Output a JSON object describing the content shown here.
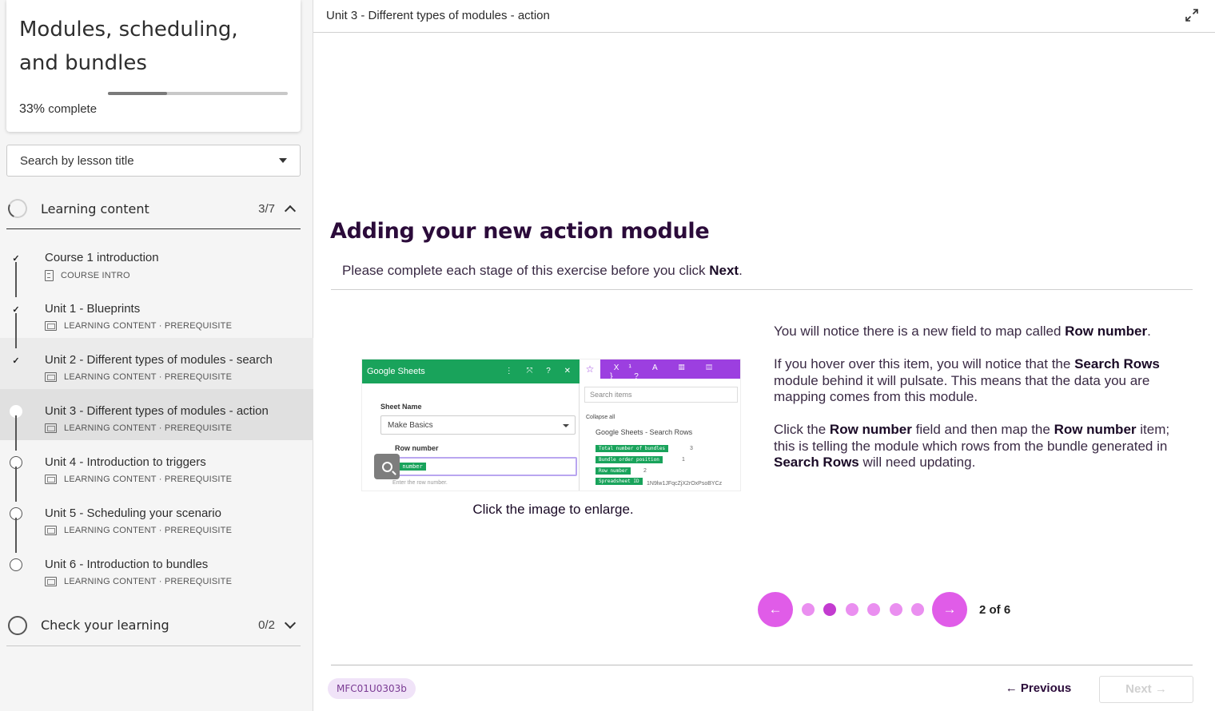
{
  "sidebar": {
    "course_title": "Modules, scheduling, and bundles",
    "progress_percent": 33,
    "progress_pct_label": "33%",
    "progress_suffix": "complete",
    "search_placeholder": "Search by lesson title",
    "section1": {
      "label": "Learning content",
      "count": "3/7",
      "expanded": true
    },
    "lessons": [
      {
        "title": "Course 1 introduction",
        "meta": "COURSE INTRO",
        "status": "done"
      },
      {
        "title": "Unit 1 - Blueprints",
        "meta": "LEARNING CONTENT · PREREQUISITE",
        "status": "done"
      },
      {
        "title": "Unit 2 - Different types of modules - search",
        "meta": "LEARNING CONTENT · PREREQUISITE",
        "status": "done"
      },
      {
        "title": "Unit 3 - Different types of modules - action",
        "meta": "LEARNING CONTENT · PREREQUISITE",
        "status": "current"
      },
      {
        "title": "Unit 4 - Introduction to triggers",
        "meta": "LEARNING CONTENT · PREREQUISITE",
        "status": "todo"
      },
      {
        "title": "Unit 5 - Scheduling your scenario",
        "meta": "LEARNING CONTENT · PREREQUISITE",
        "status": "todo"
      },
      {
        "title": "Unit 6 - Introduction to bundles",
        "meta": "LEARNING CONTENT · PREREQUISITE",
        "status": "todo"
      }
    ],
    "check_mark": "✓",
    "section2": {
      "label": "Check your learning",
      "count": "0/2",
      "expanded": false
    }
  },
  "main": {
    "top_title": "Unit 3 - Different types of modules - action",
    "heading": "Adding your new action module",
    "instruction_prefix": "Please complete each stage of this exercise before you click ",
    "instruction_bold": "Next",
    "instruction_suffix": ".",
    "image": {
      "gs_title": "Google Sheets",
      "gs_tools": "⋮ ⤧ ? ✕",
      "sheet_name_label": "Sheet Name",
      "sheet_name_value": "Make Basics",
      "row_number_label": "Row number",
      "row_pill": "w number",
      "row_hint": "Enter the row number.",
      "picker_icons": "⎈ X¹ A ▦ ▤ { } ?",
      "picker_star": "☆",
      "picker_search": "Search items",
      "collapse_all": "Collapse all",
      "tree_parent": "Google Sheets",
      "tree_parent_suffix": "- Search Rows",
      "tags": [
        "Total number of bundles",
        "Bundle order position",
        "Row number",
        "Spreadsheet ID"
      ],
      "tag_values": [
        "3",
        "1",
        "2",
        "1N9lw1JFqcZjX2rOxPsoBYCz"
      ],
      "caption": "Click the image to enlarge."
    },
    "paragraphs": [
      {
        "parts": [
          [
            "You will notice there is a new field to map called ",
            false
          ],
          [
            "Row number",
            true
          ],
          [
            ".",
            false
          ]
        ]
      },
      {
        "parts": [
          [
            "If you hover over this item, you will notice that the ",
            false
          ],
          [
            "Search Rows",
            true
          ],
          [
            " module behind it will pulsate. This means that the data you are mapping comes from this module.",
            false
          ]
        ]
      },
      {
        "parts": [
          [
            "Click the ",
            false
          ],
          [
            "Row number",
            true
          ],
          [
            " field and then map the ",
            false
          ],
          [
            "Row number",
            true
          ],
          [
            " item; this is telling the module which rows from the bundle generated in ",
            false
          ],
          [
            "Search Rows",
            true
          ],
          [
            " will need updating.",
            false
          ]
        ]
      }
    ],
    "pager": {
      "current": 2,
      "total": 6,
      "label": "2 of 6",
      "prev_icon": "←",
      "next_icon": "→"
    },
    "code": "MFC01U0303b",
    "prev_label": "← Previous",
    "next_label": "Next →"
  },
  "colors": {
    "accent": "#e05ce8",
    "dot": "#ea8ff0",
    "dot_active": "#c33bd0",
    "heading": "#2b0b3a",
    "badge_bg": "#f0e3f8",
    "badge_fg": "#7a3b93"
  }
}
